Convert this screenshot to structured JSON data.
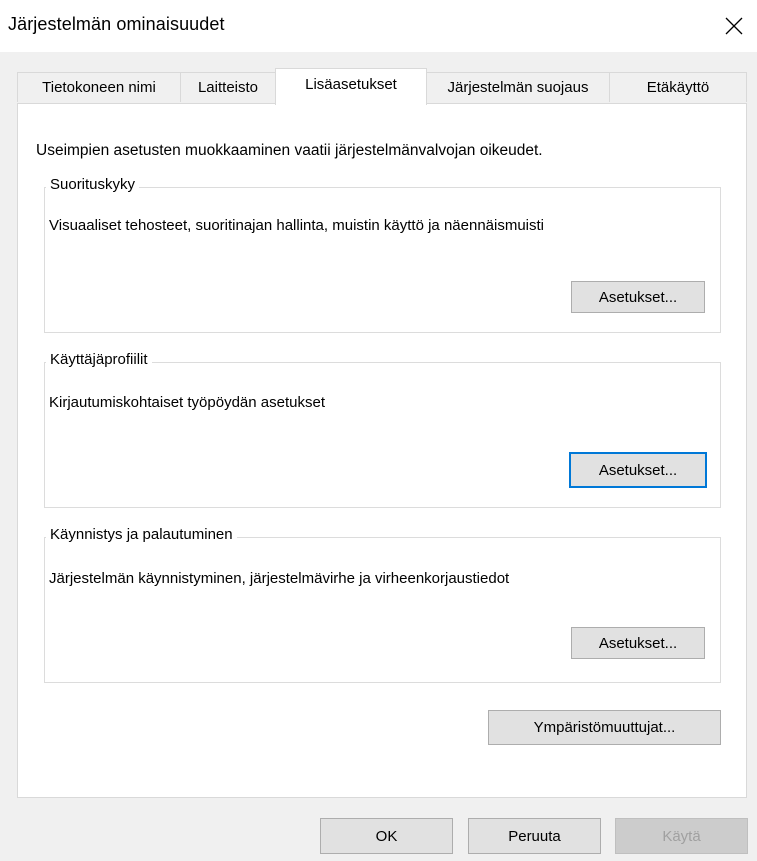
{
  "window": {
    "title": "Järjestelmän ominaisuudet",
    "close_icon": "close-icon"
  },
  "tabs": [
    {
      "label": "Tietokoneen nimi"
    },
    {
      "label": "Laitteisto"
    },
    {
      "label": "Lisäasetukset",
      "active": true
    },
    {
      "label": "Järjestelmän suojaus"
    },
    {
      "label": "Etäkäyttö"
    }
  ],
  "intro_text": "Useimpien asetusten muokkaaminen vaatii järjestelmänvalvojan oikeudet.",
  "groups": {
    "performance": {
      "title": "Suorituskyky",
      "description": "Visuaaliset tehosteet, suoritinajan hallinta, muistin käyttö ja näennäismuisti",
      "button": "Asetukset..."
    },
    "user_profiles": {
      "title": "Käyttäjäprofiilit",
      "description": "Kirjautumiskohtaiset työpöydän asetukset",
      "button": "Asetukset..."
    },
    "startup_recovery": {
      "title": "Käynnistys ja palautuminen",
      "description": "Järjestelmän käynnistyminen, järjestelmävirhe ja virheenkorjaustiedot",
      "button": "Asetukset..."
    }
  },
  "environment_button": "Ympäristömuuttujat...",
  "footer": {
    "ok": "OK",
    "cancel": "Peruuta",
    "apply": "Käytä"
  },
  "colors": {
    "focus": "#0078d7",
    "panel": "#ffffff",
    "dialog": "#f0f0f0"
  }
}
